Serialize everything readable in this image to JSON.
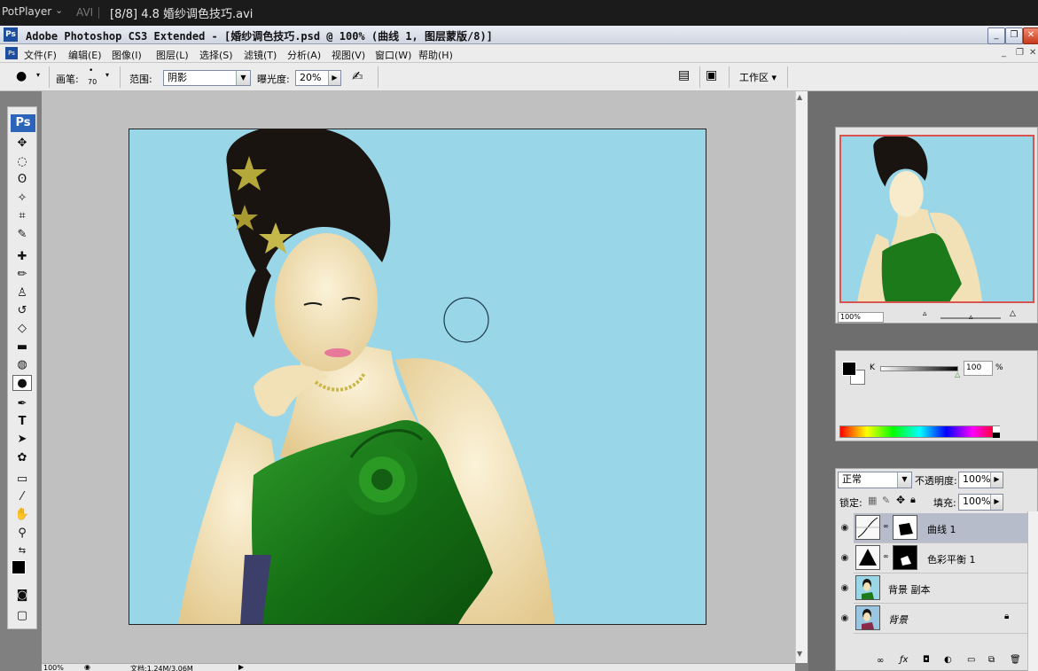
{
  "player": {
    "name": "PotPlayer",
    "format": "AVI",
    "file_title": "[8/8] 4.8 婚纱调色技巧.avi"
  },
  "ps_window": {
    "title": "Adobe Photoshop CS3 Extended - [婚纱调色技巧.psd @ 100% (曲线 1, 图层蒙版/8)]",
    "minimize": "_",
    "restore": "❐",
    "close": "✕"
  },
  "menu": {
    "items": [
      "文件(F)",
      "编辑(E)",
      "图像(I)",
      "图层(L)",
      "选择(S)",
      "滤镜(T)",
      "分析(A)",
      "视图(V)",
      "窗口(W)",
      "帮助(H)"
    ],
    "doc_min": "_",
    "doc_restore": "❐",
    "doc_close": "✕"
  },
  "options": {
    "brush_label": "画笔:",
    "brush_size": "70",
    "range_label": "范围:",
    "range_value": "阴影",
    "exposure_label": "曝光度:",
    "exposure_value": "20%",
    "workspace_label": "工作区 ▾"
  },
  "statusbar": {
    "zoom": "100%",
    "doc_size": "文档:1.24M/3.06M"
  },
  "navigator": {
    "zoom": "100%"
  },
  "color": {
    "channel": "K",
    "value": "100",
    "unit": "%"
  },
  "layers_panel": {
    "blend_mode": "正常",
    "opacity_label": "不透明度:",
    "opacity_value": "100%",
    "lock_label": "锁定:",
    "fill_label": "填充:",
    "fill_value": "100%",
    "layers": [
      {
        "name": "曲线 1",
        "active": true
      },
      {
        "name": "色彩平衡 1",
        "active": false
      },
      {
        "name": "背景 副本",
        "active": false
      },
      {
        "name": "背景",
        "active": false
      }
    ]
  },
  "colors": {
    "canvas_bg": "#99d6e8",
    "dress": "#1f7a1f",
    "ps_blue": "#2b64b8"
  }
}
